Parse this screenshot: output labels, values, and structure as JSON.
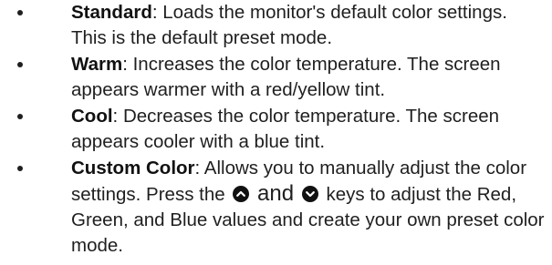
{
  "items": [
    {
      "term": "Standard",
      "text": ": Loads the monitor's default color settings. This is the default preset mode."
    },
    {
      "term": "Warm",
      "text": ": Increases the color temperature. The screen appears warmer with a red/yellow tint."
    },
    {
      "term": "Cool",
      "text": ": Decreases the color temperature. The screen appears cooler with a blue tint."
    },
    {
      "term": "Custom Color",
      "text_before": ": Allows you to manually adjust the color settings. Press the",
      "and_word": "and",
      "text_after": "keys to adjust the Red, Green, and Blue values and create your own preset color mode."
    }
  ],
  "icons": {
    "up": "up-arrow-key-icon",
    "down": "down-arrow-key-icon"
  }
}
